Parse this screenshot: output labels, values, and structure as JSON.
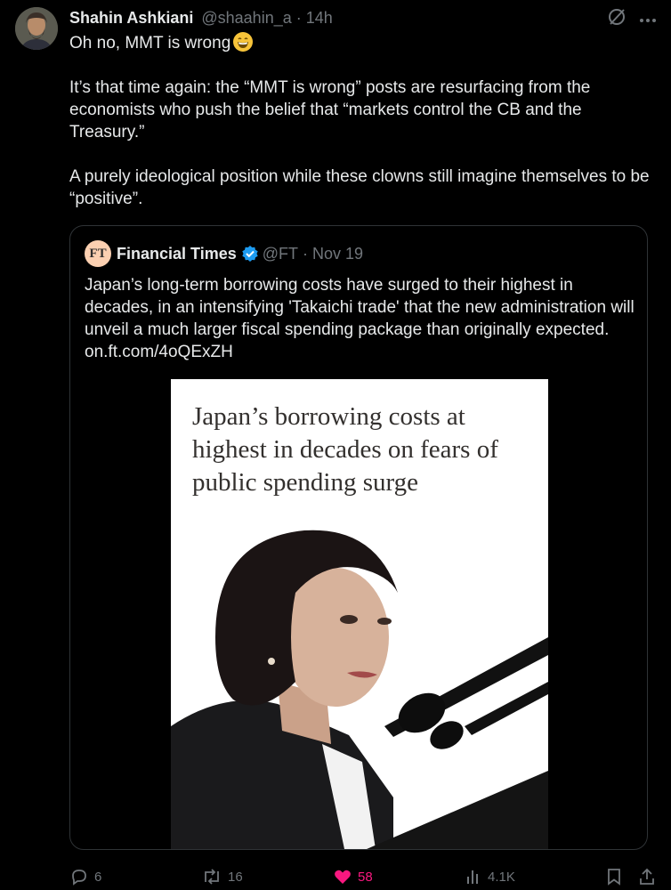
{
  "author": {
    "name": "Shahin Ashkiani",
    "handle": "@shaahin_a",
    "separator": "·",
    "time": "14h",
    "avatar_icon": "user-avatar"
  },
  "post": {
    "line1": "Oh no, MMT is wrong",
    "emoji_icon": "grinning-face-emoji",
    "para1": "It’s that time again: the “MMT is wrong” posts are resurfacing from the economists who push the belief that “markets control the CB and the Treasury.”",
    "para2": "A purely ideological position while these clowns still imagine themselves to be “positive”."
  },
  "quoted": {
    "logo_text": "FT",
    "name": "Financial Times",
    "handle": "@FT",
    "separator": "·",
    "date": "Nov 19",
    "text": "Japan’s long-term borrowing costs have surged to their highest in decades, in an intensifying 'Takaichi trade' that the new administration will unveil a much larger fiscal spending package than originally expected. on.ft.com/4oQExZH",
    "image_headline": "Japan’s borrowing costs at highest in decades on fears of public spending surge"
  },
  "actions": {
    "replies": "6",
    "reposts": "16",
    "likes": "58",
    "views": "4.1K"
  },
  "colors": {
    "background": "#000000",
    "text": "#e7e9ea",
    "muted": "#71767b",
    "border": "#2f3336",
    "verified": "#1d9bf0",
    "like": "#f91880",
    "ft_pink": "#fcd0b1"
  }
}
